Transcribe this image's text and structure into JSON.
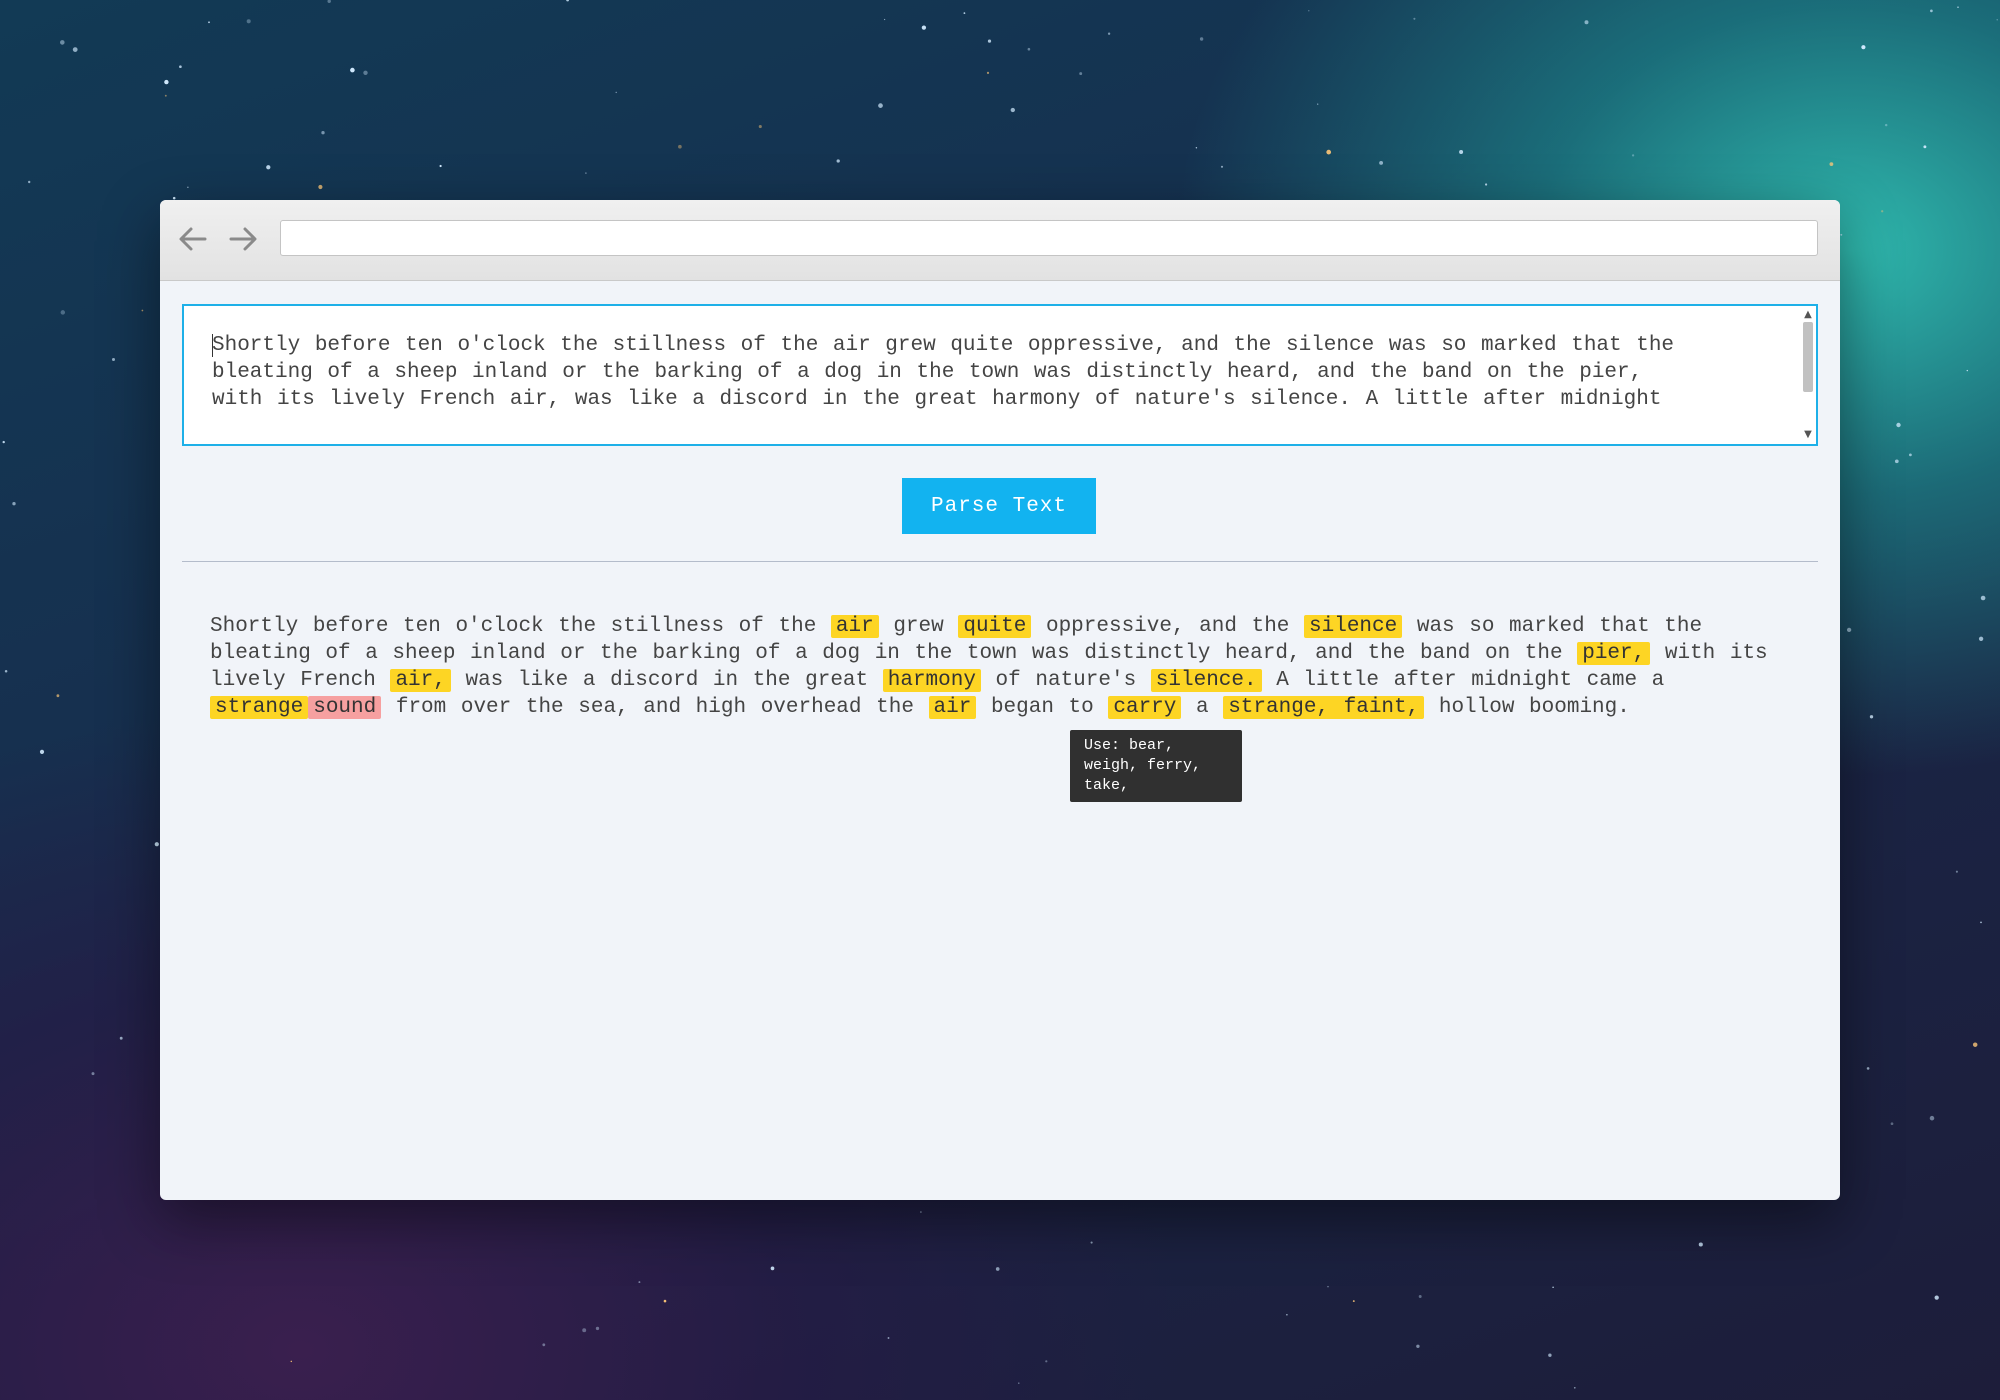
{
  "browser": {
    "url": ""
  },
  "editor": {
    "text": "Shortly before ten o'clock the stillness of the air grew quite oppressive, and the silence was so marked that the\nbleating of a sheep inland or the barking of a dog in the town was distinctly heard, and the band on the pier,\nwith its lively French air, was like a discord in the great harmony of nature's silence. A little after midnight"
  },
  "parse_button": {
    "label": "Parse Text"
  },
  "output": {
    "segments": [
      {
        "text": "Shortly before ten o'clock the stillness of the ",
        "hl": null
      },
      {
        "text": "air",
        "hl": "yellow"
      },
      {
        "text": " grew ",
        "hl": null
      },
      {
        "text": "quite",
        "hl": "yellow"
      },
      {
        "text": " oppressive, and the ",
        "hl": null
      },
      {
        "text": "silence",
        "hl": "yellow"
      },
      {
        "text": " was so marked that the bleating of a sheep inland or the barking of a dog in the town was distinctly heard, and the band on the ",
        "hl": null
      },
      {
        "text": "pier,",
        "hl": "yellow"
      },
      {
        "text": " with its lively French ",
        "hl": null
      },
      {
        "text": "air,",
        "hl": "yellow"
      },
      {
        "text": " was like a discord in the great ",
        "hl": null
      },
      {
        "text": "harmony",
        "hl": "yellow"
      },
      {
        "text": " of nature's ",
        "hl": null
      },
      {
        "text": "silence.",
        "hl": "yellow"
      },
      {
        "text": " A little after midnight came a ",
        "hl": null
      },
      {
        "text": "strange",
        "hl": "yellow"
      },
      {
        "text": "sound",
        "hl": "red"
      },
      {
        "text": " from over the sea, and high overhead the ",
        "hl": null
      },
      {
        "text": "air",
        "hl": "yellow"
      },
      {
        "text": " began to ",
        "hl": null
      },
      {
        "text": "carry",
        "hl": "yellow"
      },
      {
        "text": " a ",
        "hl": null
      },
      {
        "text": "strange, faint,",
        "hl": "yellow"
      },
      {
        "text": " hollow booming.",
        "hl": null
      }
    ]
  },
  "tooltip": {
    "text": "Use: bear,\nweigh, ferry,\ntake,"
  },
  "colors": {
    "highlight_yellow": "#fdd524",
    "highlight_red": "#f6a0a0",
    "accent": "#12b3f0"
  },
  "icons": {
    "back": "arrow-left-icon",
    "forward": "arrow-right-icon"
  }
}
